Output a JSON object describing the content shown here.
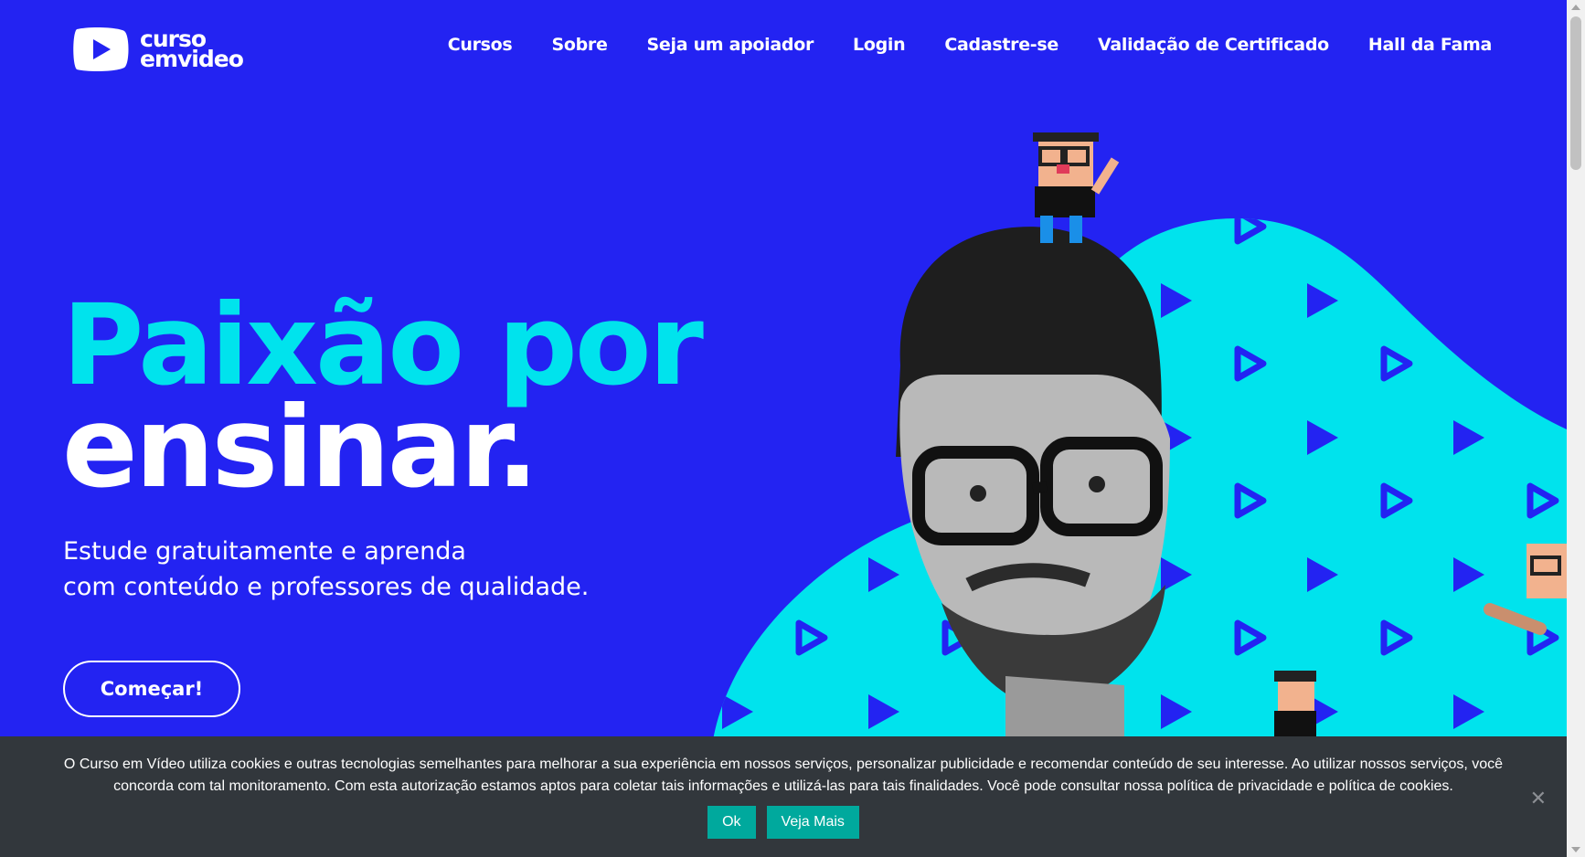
{
  "logo": {
    "line1": "curso",
    "line2": "emvideo"
  },
  "nav": [
    {
      "label": "Cursos"
    },
    {
      "label": "Sobre"
    },
    {
      "label": "Seja um apoiador"
    },
    {
      "label": "Login"
    },
    {
      "label": "Cadastre-se"
    },
    {
      "label": "Validação de Certificado"
    },
    {
      "label": "Hall da Fama"
    }
  ],
  "hero": {
    "title_line1": "Paixão por",
    "title_line2": "ensinar.",
    "subtitle_line1": "Estude gratuitamente e aprenda",
    "subtitle_line2": "com conteúdo e professores de qualidade.",
    "cta_label": "Começar!"
  },
  "cookie": {
    "text": "O Curso em Vídeo utiliza cookies e outras tecnologias semelhantes para melhorar a sua experiência em nossos serviços, personalizar publicidade e recomendar conteúdo de seu interesse. Ao utilizar nossos serviços, você concorda com tal monitoramento. Com esta autorização estamos aptos para coletar tais informações e utilizá-las para tais finalidades. Você pode consultar nossa política de privacidade e política de cookies.",
    "ok_label": "Ok",
    "more_label": "Veja Mais",
    "close_glyph": "✕"
  },
  "colors": {
    "background": "#2323f2",
    "accent_cyan": "#00e3ed",
    "cookie_bg": "#32373c",
    "cookie_button": "#00a99d"
  },
  "icons": [
    "play-logo-icon",
    "close-icon",
    "scroll-up-icon",
    "scroll-down-icon"
  ]
}
